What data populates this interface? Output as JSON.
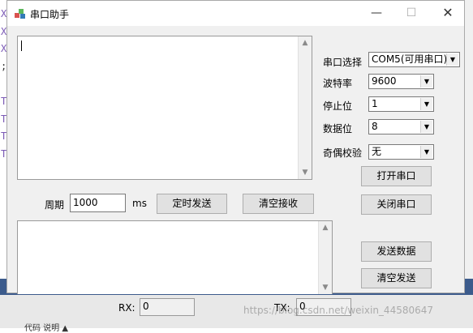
{
  "window": {
    "title": "串口助手",
    "minimize_glyph": "—",
    "maximize_glyph": "☐",
    "close_glyph": "✕"
  },
  "background": {
    "left_chars": [
      "X",
      "X",
      "X",
      ";",
      "T",
      "T",
      "T",
      "T"
    ],
    "tab_header": "代码   说明 ▲"
  },
  "serial": {
    "port_label": "串口选择",
    "port_value": "COM5(可用串口)",
    "baud_label": "波特率",
    "baud_value": "9600",
    "stop_label": "停止位",
    "stop_value": "1",
    "data_label": "数据位",
    "data_value": "8",
    "parity_label": "奇偶校验",
    "parity_value": "无",
    "open_label": "打开串口",
    "close_label": "关闭串口"
  },
  "timer": {
    "period_label": "周期",
    "period_value": "1000",
    "unit": "ms",
    "timed_send_label": "定时发送",
    "clear_receive_label": "清空接收"
  },
  "send": {
    "send_label": "发送数据",
    "clear_send_label": "清空发送"
  },
  "counters": {
    "rx_label": "RX:",
    "rx_value": "0",
    "tx_label": "TX:",
    "tx_value": "0"
  },
  "watermark": "https://blog.csdn.net/weixin_44580647"
}
